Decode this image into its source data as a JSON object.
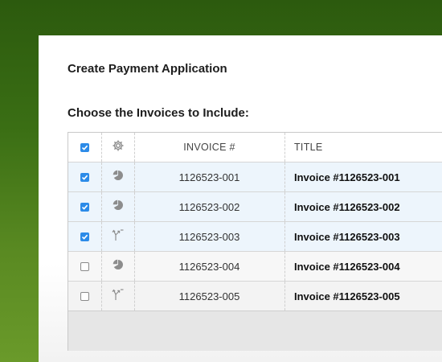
{
  "dialog": {
    "title": "Create Payment Application",
    "subtitle": "Choose the Invoices to Include:"
  },
  "table": {
    "header_checkbox_checked": true,
    "header_icon": "gear-icon",
    "columns": [
      "INVOICE #",
      "TITLE"
    ],
    "rows": [
      {
        "checked": true,
        "icon": "pie-chart-icon",
        "invoice_number": "1126523-001",
        "title": "Invoice #1126523-001"
      },
      {
        "checked": true,
        "icon": "pie-chart-icon",
        "invoice_number": "1126523-002",
        "title": "Invoice #1126523-002"
      },
      {
        "checked": true,
        "icon": "split-arrow-icon",
        "invoice_number": "1126523-003",
        "title": "Invoice #1126523-003"
      },
      {
        "checked": false,
        "icon": "pie-chart-icon",
        "invoice_number": "1126523-004",
        "title": "Invoice #1126523-004"
      },
      {
        "checked": false,
        "icon": "split-arrow-icon",
        "invoice_number": "1126523-005",
        "title": "Invoice #1126523-005"
      }
    ]
  },
  "colors": {
    "checkbox_accent": "#2c8be8",
    "selected_row": "#edf5fc",
    "background_green": "#3a6e14"
  }
}
